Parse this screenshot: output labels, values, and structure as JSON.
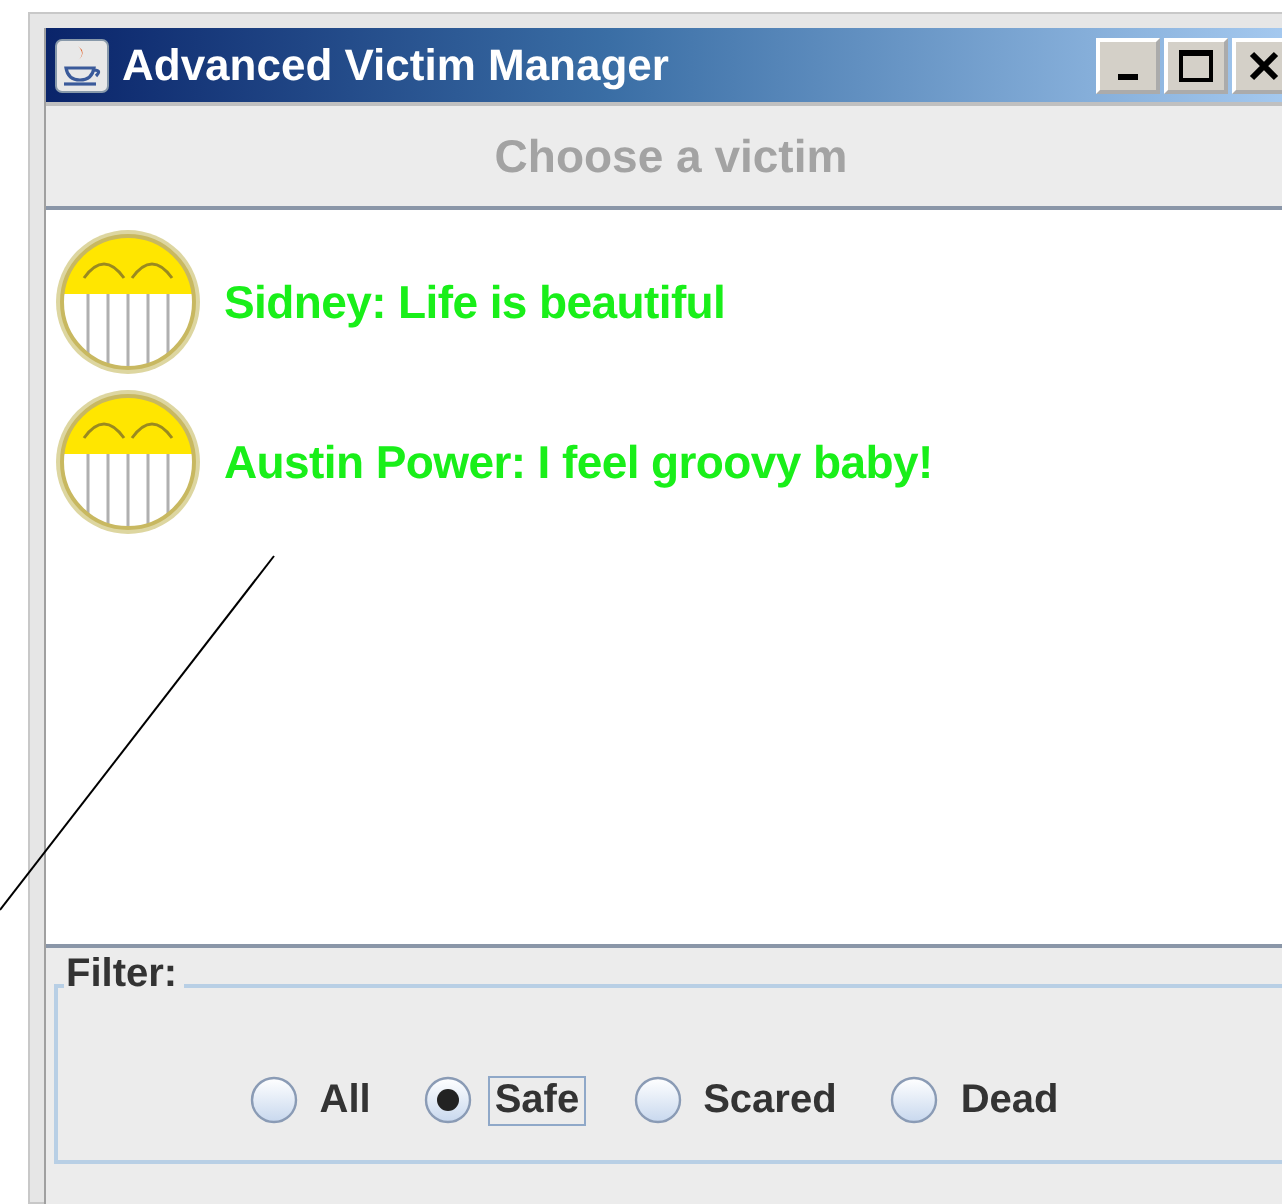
{
  "window": {
    "title": "Advanced Victim Manager"
  },
  "header": {
    "label": "Choose a victim"
  },
  "victims": [
    {
      "text": "Sidney: Life is beautiful"
    },
    {
      "text": "Austin Power: I feel groovy baby!"
    }
  ],
  "filter": {
    "title": "Filter:",
    "options": [
      {
        "label": "All",
        "selected": false,
        "focused": false
      },
      {
        "label": "Safe",
        "selected": true,
        "focused": true
      },
      {
        "label": "Scared",
        "selected": false,
        "focused": false
      },
      {
        "label": "Dead",
        "selected": false,
        "focused": false
      }
    ]
  }
}
